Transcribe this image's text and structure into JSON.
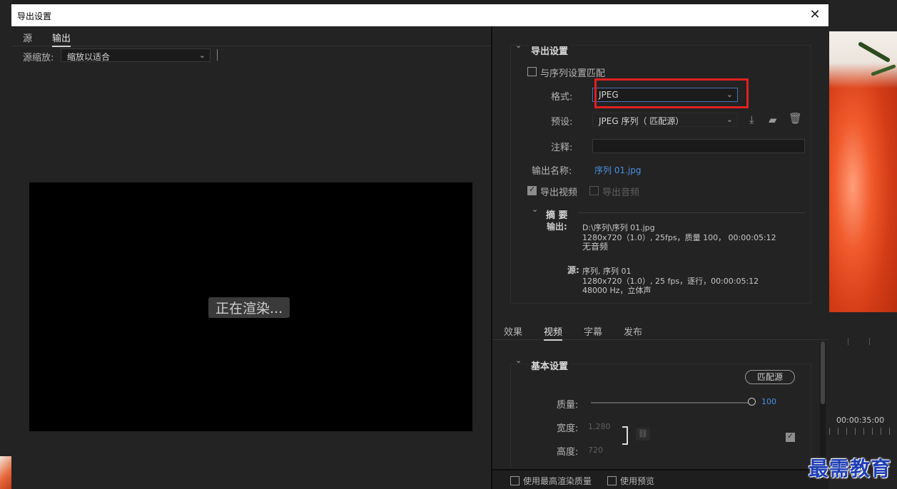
{
  "dialog": {
    "title": "导出设置"
  },
  "left": {
    "tabs": [
      "源",
      "输出"
    ],
    "scale_label": "源缩放:",
    "scale_value": "缩放以适合",
    "render_label": "正在渲染..."
  },
  "export_settings": {
    "section_title": "导出设置",
    "match_sequence_label": "与序列设置匹配",
    "format_label": "格式:",
    "format_value": "JPEG",
    "preset_label": "预设:",
    "preset_value": "JPEG 序列（ 匹配源）",
    "comment_label": "注释:",
    "output_name_label": "输出名称:",
    "output_name_value": "序列 01.jpg",
    "export_video_label": "导出视频",
    "export_audio_label": "导出音频",
    "summary_title": "摘 要",
    "summary_output_label": "输出:",
    "summary_output_lines": [
      "D:\\序列\\序列 01.jpg",
      "1280x720（1.0）, 25fps，质量 100， 00:00:05:12",
      "无音频"
    ],
    "summary_source_label": "源:",
    "summary_source_lines": [
      "序列, 序列 01",
      "1280x720（1.0）, 25 fps，逐行，00:00:05:12",
      "48000 Hz，立体声"
    ]
  },
  "tabs": [
    "效果",
    "视频",
    "字幕",
    "发布"
  ],
  "basic_settings": {
    "title": "基本设置",
    "match_source_button": "匹配源",
    "quality_label": "质量:",
    "quality_value": "100",
    "width_label": "宽度:",
    "width_value": "1,280",
    "height_label": "高度:",
    "height_value": "720"
  },
  "bottom": {
    "max_render_quality_label": "使用最高渲染质量",
    "use_previews_label": "使用预览"
  },
  "background": {
    "timecode": "00:00:35:00",
    "watermark": "最需教育"
  },
  "colors": {
    "highlight": "#e02020",
    "link": "#4a90e2",
    "panel": "#232323"
  }
}
